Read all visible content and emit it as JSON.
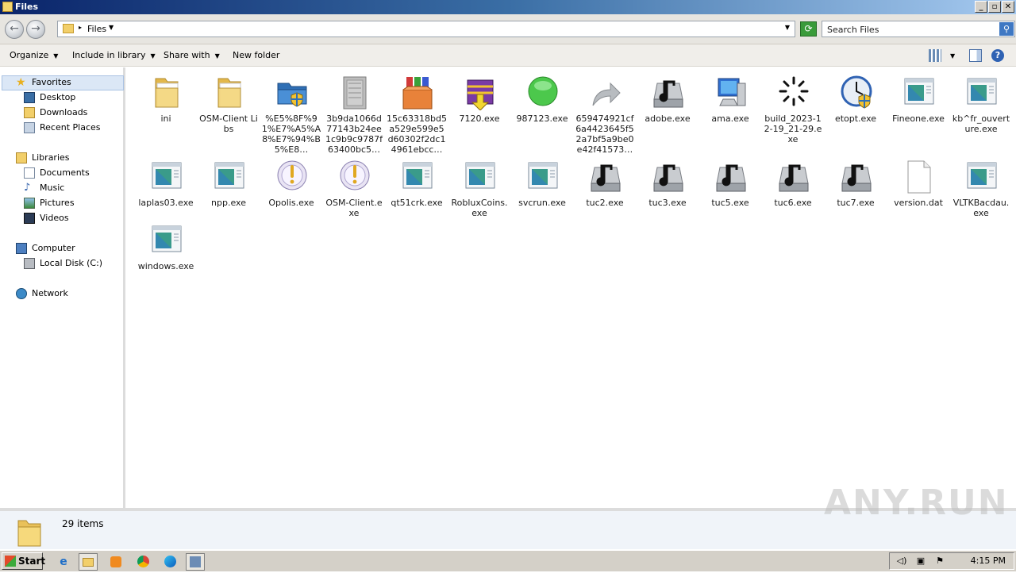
{
  "window": {
    "title": "Files"
  },
  "address": {
    "crumb": "Files",
    "search_placeholder": "Search Files"
  },
  "toolbar": {
    "organize": "Organize",
    "include": "Include in library",
    "share": "Share with",
    "newfolder": "New folder"
  },
  "sidebar": {
    "favorites": "Favorites",
    "desktop": "Desktop",
    "downloads": "Downloads",
    "recent": "Recent Places",
    "libraries": "Libraries",
    "documents": "Documents",
    "music": "Music",
    "pictures": "Pictures",
    "videos": "Videos",
    "computer": "Computer",
    "localdisk": "Local Disk (C:)",
    "network": "Network"
  },
  "files": [
    {
      "name": "ini",
      "icon": "folder-icon"
    },
    {
      "name": "OSM-Client Libs",
      "icon": "folder-icon"
    },
    {
      "name": "%E5%8F%91%E7%A5%A8%E7%94%B5%E8…",
      "icon": "shield-folder-icon"
    },
    {
      "name": "3b9da1066d77143b24ee1c9b9c9787f63400bc5…",
      "icon": "generic-exe-icon"
    },
    {
      "name": "15c63318bd5a529e599e5d60302f2dc14961ebcc…",
      "icon": "winrar-box-icon"
    },
    {
      "name": "7120.exe",
      "icon": "winrar-install-icon"
    },
    {
      "name": "987123.exe",
      "icon": "green-circle-icon"
    },
    {
      "name": "659474921cf6a4423645f52a7bf5a9be0e42f41573…",
      "icon": "arrow-icon"
    },
    {
      "name": "adobe.exe",
      "icon": "music-drive-icon"
    },
    {
      "name": "ama.exe",
      "icon": "computer-icon"
    },
    {
      "name": "build_2023-12-19_21-29.exe",
      "icon": "spinner-icon"
    },
    {
      "name": "etopt.exe",
      "icon": "clock-shield-icon"
    },
    {
      "name": "Fineone.exe",
      "icon": "window-app-icon"
    },
    {
      "name": "kb^fr_ouverture.exe",
      "icon": "window-app-icon"
    },
    {
      "name": "laplas03.exe",
      "icon": "window-app-icon"
    },
    {
      "name": "npp.exe",
      "icon": "window-app-icon"
    },
    {
      "name": "Opolis.exe",
      "icon": "warning-disc-icon"
    },
    {
      "name": "OSM-Client.exe",
      "icon": "warning-disc-icon"
    },
    {
      "name": "qt51crk.exe",
      "icon": "window-app-icon"
    },
    {
      "name": "RobluxCoins.exe",
      "icon": "window-app-icon"
    },
    {
      "name": "svcrun.exe",
      "icon": "window-app-icon"
    },
    {
      "name": "tuc2.exe",
      "icon": "music-drive-icon"
    },
    {
      "name": "tuc3.exe",
      "icon": "music-drive-icon"
    },
    {
      "name": "tuc5.exe",
      "icon": "music-drive-icon"
    },
    {
      "name": "tuc6.exe",
      "icon": "music-drive-icon"
    },
    {
      "name": "tuc7.exe",
      "icon": "music-drive-icon"
    },
    {
      "name": "version.dat",
      "icon": "blank-file-icon"
    },
    {
      "name": "VLTKBacdau.exe",
      "icon": "window-app-icon"
    },
    {
      "name": "windows.exe",
      "icon": "window-app-icon"
    }
  ],
  "status": {
    "count": "29 items"
  },
  "taskbar": {
    "start": "Start",
    "clock": "4:15 PM"
  },
  "watermark": "ANY.RUN"
}
